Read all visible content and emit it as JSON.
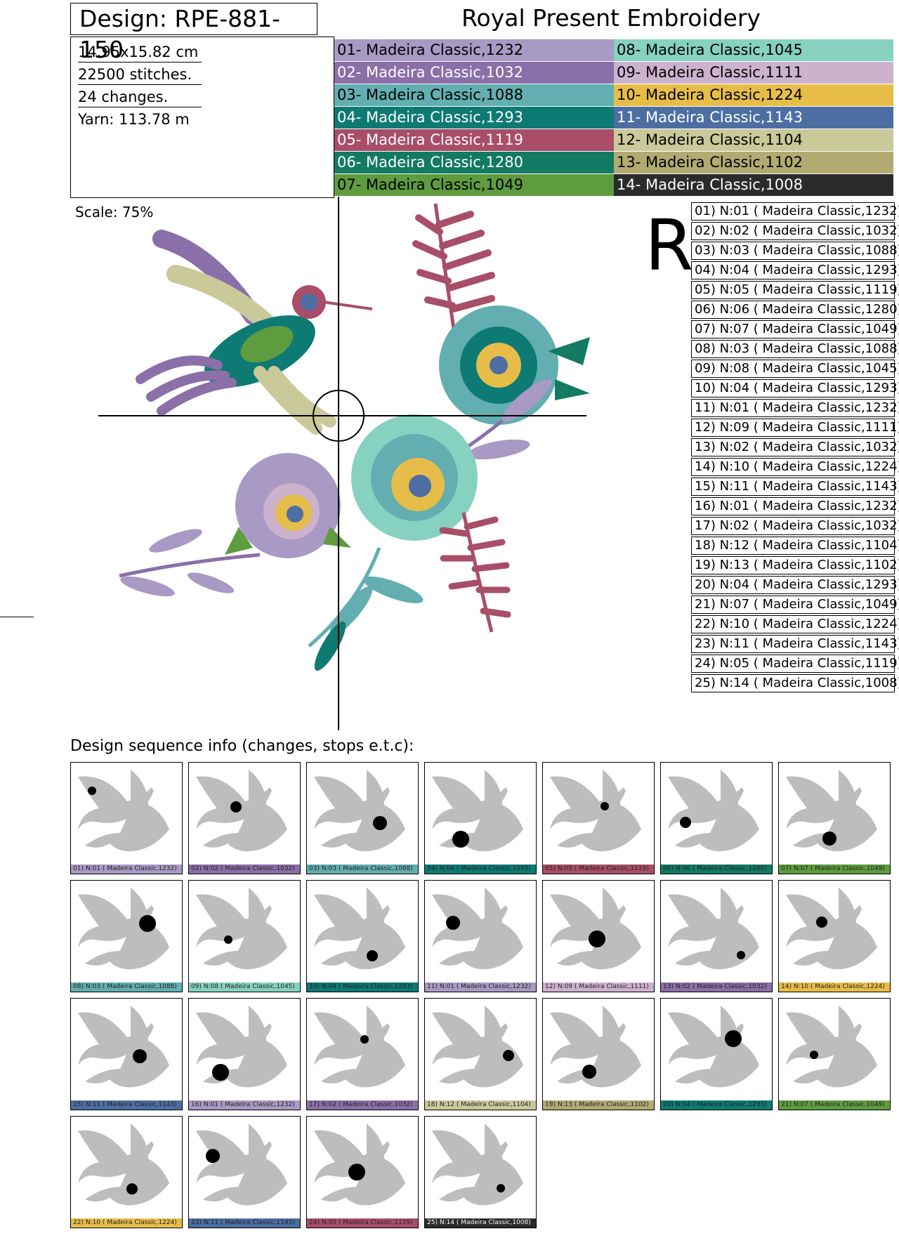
{
  "header": {
    "design_title": "Design: RPE-881-150",
    "brand_title": "Royal Present Embroidery"
  },
  "stats": {
    "size": "14.95x15.82 cm",
    "stitches": "22500 stitches.",
    "changes": "24 changes.",
    "yarn": "Yarn: 113.78 m"
  },
  "palette": [
    {
      "label": "01- Madeira Classic,1232",
      "color": "#a89ac4",
      "text": "#000"
    },
    {
      "label": "02- Madeira Classic,1032",
      "color": "#8a6fa8",
      "text": "#fff"
    },
    {
      "label": "03- Madeira Classic,1088",
      "color": "#62aeb0",
      "text": "#000"
    },
    {
      "label": "04- Madeira Classic,1293",
      "color": "#0e7a74",
      "text": "#fff"
    },
    {
      "label": "05- Madeira Classic,1119",
      "color": "#a84e68",
      "text": "#fff"
    },
    {
      "label": "06- Madeira Classic,1280",
      "color": "#137a63",
      "text": "#fff"
    },
    {
      "label": "07- Madeira Classic,1049",
      "color": "#5e9c3f",
      "text": "#000"
    },
    {
      "label": "08- Madeira Classic,1045",
      "color": "#86d1c0",
      "text": "#000"
    },
    {
      "label": "09- Madeira Classic,1111",
      "color": "#cdb2ce",
      "text": "#000"
    },
    {
      "label": "10- Madeira Classic,1224",
      "color": "#e7bd4a",
      "text": "#000"
    },
    {
      "label": "11- Madeira Classic,1143",
      "color": "#4c6ea3",
      "text": "#fff"
    },
    {
      "label": "12- Madeira Classic,1104",
      "color": "#c9c99a",
      "text": "#000"
    },
    {
      "label": "13- Madeira Classic,1102",
      "color": "#b3aa72",
      "text": "#000"
    },
    {
      "label": "14- Madeira Classic,1008",
      "color": "#2b2b2b",
      "text": "#fff"
    }
  ],
  "scale_label": "Scale: 75%",
  "r_mark": "R",
  "sequence": [
    "01) N:01 ( Madeira Classic,1232)",
    "02) N:02 ( Madeira Classic,1032)",
    "03) N:03 ( Madeira Classic,1088)",
    "04) N:04 ( Madeira Classic,1293)",
    "05) N:05 ( Madeira Classic,1119)",
    "06) N:06 ( Madeira Classic,1280)",
    "07) N:07 ( Madeira Classic,1049)",
    "08) N:03 ( Madeira Classic,1088)",
    "09) N:08 ( Madeira Classic,1045)",
    "10) N:04 ( Madeira Classic,1293)",
    "11) N:01 ( Madeira Classic,1232)",
    "12) N:09 ( Madeira Classic,1111)",
    "13) N:02 ( Madeira Classic,1032)",
    "14) N:10 ( Madeira Classic,1224)",
    "15) N:11 ( Madeira Classic,1143)",
    "16) N:01 ( Madeira Classic,1232)",
    "17) N:02 ( Madeira Classic,1032)",
    "18) N:12 ( Madeira Classic,1104)",
    "19) N:13 ( Madeira Classic,1102)",
    "20) N:04 ( Madeira Classic,1293)",
    "21) N:07 ( Madeira Classic,1049)",
    "22) N:10 ( Madeira Classic,1224)",
    "23) N:11 ( Madeira Classic,1143)",
    "24) N:05 ( Madeira Classic,1119)",
    "25) N:14 ( Madeira Classic,1008)"
  ],
  "sequence_heading": "Design sequence info (changes, stops e.t.c):",
  "thumbnails": [
    {
      "label": "01) N:01 ( Madeira Classic,1232)",
      "color": "#a89ac4"
    },
    {
      "label": "02) N:02 ( Madeira Classic,1032)",
      "color": "#8a6fa8"
    },
    {
      "label": "03) N:03 ( Madeira Classic,1088)",
      "color": "#62aeb0"
    },
    {
      "label": "04) N:04 ( Madeira Classic,1293)",
      "color": "#0e7a74"
    },
    {
      "label": "05) N:05 ( Madeira Classic,1119)",
      "color": "#a84e68"
    },
    {
      "label": "06) N:06 ( Madeira Classic,1280)",
      "color": "#137a63"
    },
    {
      "label": "07) N:07 ( Madeira Classic,1049)",
      "color": "#5e9c3f"
    },
    {
      "label": "08) N:03 ( Madeira Classic,1088)",
      "color": "#62aeb0"
    },
    {
      "label": "09) N:08 ( Madeira Classic,1045)",
      "color": "#86d1c0"
    },
    {
      "label": "10) N:04 ( Madeira Classic,1293)",
      "color": "#0e7a74"
    },
    {
      "label": "11) N:01 ( Madeira Classic,1232)",
      "color": "#a89ac4"
    },
    {
      "label": "12) N:09 ( Madeira Classic,1111)",
      "color": "#cdb2ce"
    },
    {
      "label": "13) N:02 ( Madeira Classic,1032)",
      "color": "#8a6fa8"
    },
    {
      "label": "14) N:10 ( Madeira Classic,1224)",
      "color": "#e7bd4a"
    },
    {
      "label": "15) N:11 ( Madeira Classic,1143)",
      "color": "#4c6ea3"
    },
    {
      "label": "16) N:01 ( Madeira Classic,1232)",
      "color": "#a89ac4"
    },
    {
      "label": "17) N:02 ( Madeira Classic,1032)",
      "color": "#8a6fa8"
    },
    {
      "label": "18) N:12 ( Madeira Classic,1104)",
      "color": "#c9c99a"
    },
    {
      "label": "19) N:13 ( Madeira Classic,1102)",
      "color": "#b3aa72"
    },
    {
      "label": "20) N:04 ( Madeira Classic,1293)",
      "color": "#0e7a74"
    },
    {
      "label": "21) N:07 ( Madeira Classic,1049)",
      "color": "#5e9c3f"
    },
    {
      "label": "22) N:10 ( Madeira Classic,1224)",
      "color": "#e7bd4a"
    },
    {
      "label": "23) N:11 ( Madeira Classic,1143)",
      "color": "#4c6ea3"
    },
    {
      "label": "24) N:05 ( Madeira Classic,1119)",
      "color": "#a84e68"
    },
    {
      "label": "25) N:14 ( Madeira Classic,1008)",
      "color": "#2b2b2b"
    }
  ]
}
